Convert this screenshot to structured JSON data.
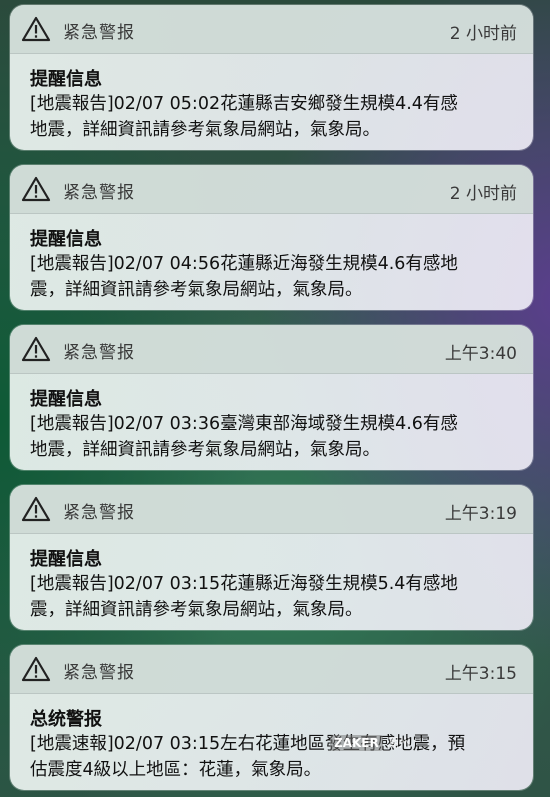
{
  "notifications": [
    {
      "app": "紧急警报",
      "time": "2 小时前",
      "title": "提醒信息",
      "body": "[地震報告]02/07 05:02花蓮縣吉安鄉發生規模4.4有感\n地震，詳細資訊請參考氣象局網站，氣象局。"
    },
    {
      "app": "紧急警报",
      "time": "2 小时前",
      "title": "提醒信息",
      "body": "[地震報告]02/07 04:56花蓮縣近海發生規模4.6有感地\n震，詳細資訊請參考氣象局網站，氣象局。"
    },
    {
      "app": "紧急警报",
      "time": "上午3:40",
      "title": "提醒信息",
      "body": "[地震報告]02/07 03:36臺灣東部海域發生規模4.6有感\n地震，詳細資訊請參考氣象局網站，氣象局。"
    },
    {
      "app": "紧急警报",
      "time": "上午3:19",
      "title": "提醒信息",
      "body": "[地震報告]02/07 03:15花蓮縣近海發生規模5.4有感地\n震，詳細資訊請參考氣象局網站，氣象局。"
    },
    {
      "app": "紧急警报",
      "time": "上午3:15",
      "title": "总统警报",
      "body": "[地震速報]02/07 03:15左右花蓮地區發生有感地震，預\n估震度4級以上地區：花蓮，氣象局。"
    }
  ],
  "watermark": {
    "logo": "ZAKER",
    "text": "潮州"
  },
  "icons": {
    "alert": "warning-triangle-icon"
  },
  "colors": {
    "card_bg": "#ecf2ef",
    "header_bg": "#cdd8d4",
    "text": "#111111"
  }
}
